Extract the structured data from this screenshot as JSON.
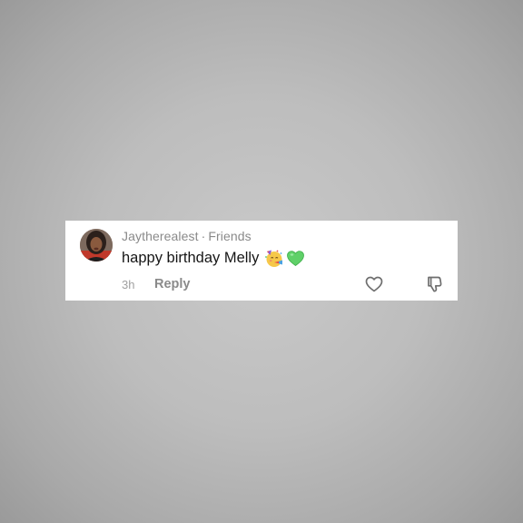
{
  "comment": {
    "username": "Jaytherealest",
    "separator": "·",
    "relationship": "Friends",
    "text": "happy birthday Melly",
    "emojis": [
      "partying-face-emoji",
      "green-heart-emoji"
    ],
    "time": "3h",
    "reply_label": "Reply"
  },
  "icons": {
    "like": "heart-outline-icon",
    "dislike": "thumbs-down-outline-icon"
  },
  "colors": {
    "background": "#b8b8b8",
    "card": "#ffffff",
    "meta_text": "#8a8a8a",
    "body_text": "#161616",
    "green_heart": "#5fd068"
  }
}
